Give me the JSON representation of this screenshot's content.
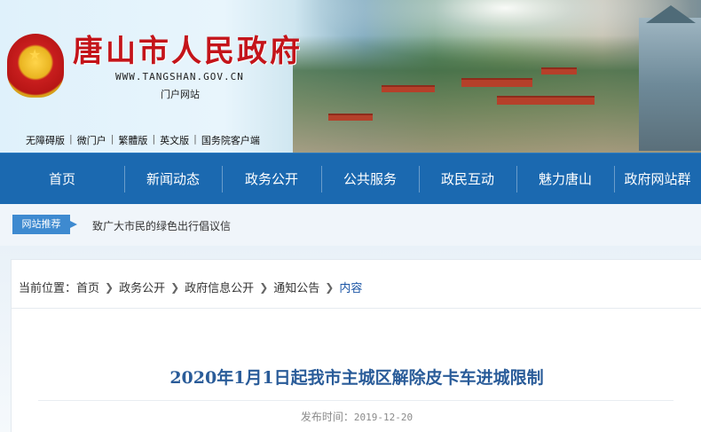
{
  "header": {
    "title": "唐山市人民政府",
    "domain": "WWW.TANGSHAN.GOV.CN",
    "portal": "门户网站",
    "top_links": [
      "无障碍版",
      "微门户",
      "繁體版",
      "英文版",
      "国务院客户端"
    ]
  },
  "nav": {
    "items": [
      "首页",
      "新闻动态",
      "政务公开",
      "公共服务",
      "政民互动",
      "魅力唐山",
      "政府网站群"
    ]
  },
  "recommend": {
    "tag": "网站推荐",
    "text": "致广大市民的绿色出行倡议信"
  },
  "breadcrumb": {
    "label": "当前位置：",
    "items": [
      "首页",
      "政务公开",
      "政府信息公开",
      "通知公告",
      "内容"
    ]
  },
  "article": {
    "title": "2020年1月1日起我市主城区解除皮卡车进城限制",
    "date_label": "发布时间：",
    "date": "2019-12-20"
  },
  "colors": {
    "nav_bg": "#1b69b0",
    "title_red": "#c4141a",
    "article_title": "#2a5c99",
    "tag_bg": "#3e8ad0"
  }
}
